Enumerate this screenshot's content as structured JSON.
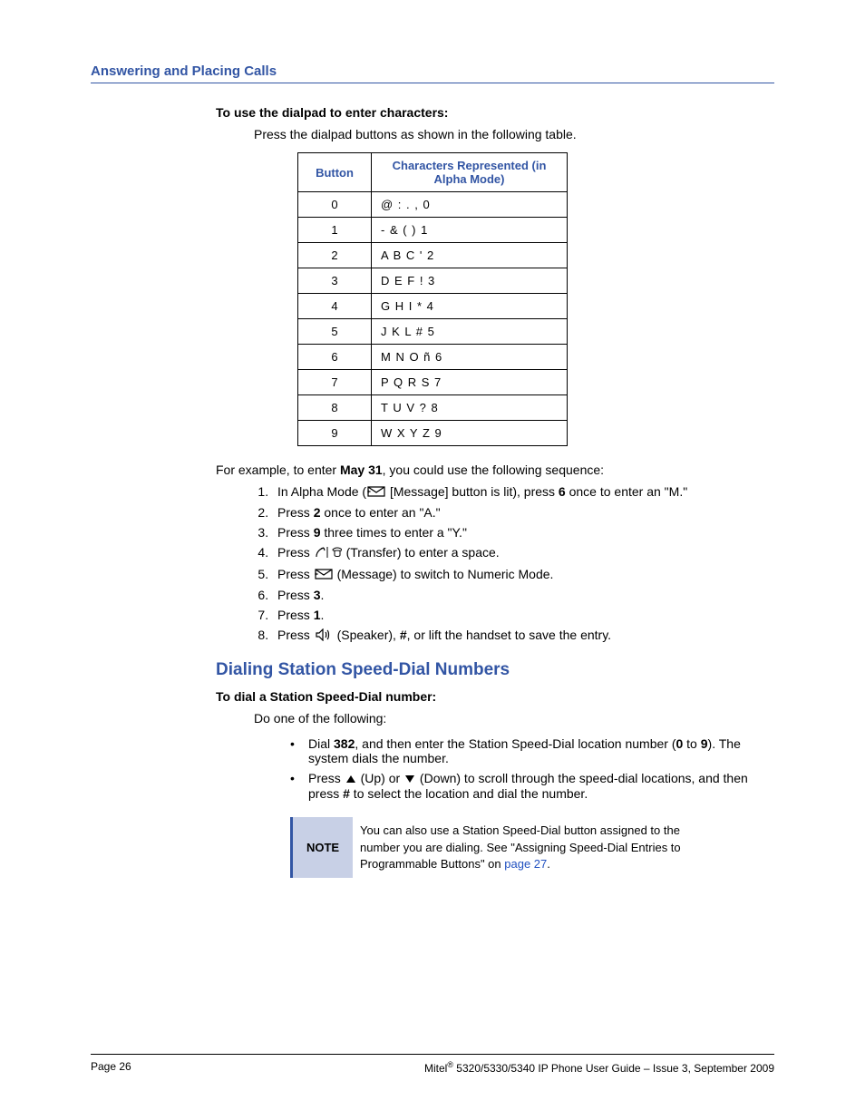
{
  "header": {
    "section": "Answering and Placing Calls"
  },
  "s1": {
    "heading": "To use the dialpad to enter characters:",
    "instruction": "Press the dialpad buttons as shown in the following table."
  },
  "table": {
    "h1": "Button",
    "h2": "Characters Represented (in Alpha Mode)",
    "rows": {
      "r0": {
        "b": "0",
        "c": "@ : . , 0"
      },
      "r1": {
        "b": "1",
        "c": "- & ( ) 1"
      },
      "r2": {
        "b": "2",
        "c": "A B C ' 2"
      },
      "r3": {
        "b": "3",
        "c": "D E F ! 3"
      },
      "r4": {
        "b": "4",
        "c": "G H I * 4"
      },
      "r5": {
        "b": "5",
        "c": "J K L # 5"
      },
      "r6": {
        "b": "6",
        "c": "M N O ñ 6"
      },
      "r7": {
        "b": "7",
        "c": "P Q R S 7"
      },
      "r8": {
        "b": "8",
        "c": "T U V ? 8"
      },
      "r9": {
        "b": "9",
        "c": "W X Y Z 9"
      }
    }
  },
  "example": {
    "intro_a": "For example, to enter ",
    "intro_b": "May 31",
    "intro_c": ", you could use the following sequence:",
    "steps": {
      "s1a": "In Alpha Mode (",
      "s1b": " [Message] button is lit), press ",
      "s1b2": "6",
      "s1c": " once to enter an \"M.\"",
      "s2a": "Press ",
      "s2b": "2",
      "s2c": " once to enter an \"A.\"",
      "s3a": "Press ",
      "s3b": "9",
      "s3c": " three times to enter a \"Y.\"",
      "s4a": "Press  ",
      "s4b": " (Transfer) to enter a space.",
      "s5a": "Press ",
      "s5b": " (Message) to switch to Numeric Mode.",
      "s6a": "Press ",
      "s6b": "3",
      "s6c": ".",
      "s7a": "Press ",
      "s7b": "1",
      "s7c": ".",
      "s8a": "Press ",
      "s8b": " (Speaker), ",
      "s8c": "#",
      "s8d": ", or lift the handset to save the entry."
    }
  },
  "s2": {
    "title": "Dialing Station Speed-Dial Numbers",
    "heading": "To dial a Station Speed-Dial number:",
    "lead": "Do one of the following:",
    "b1a": "Dial ",
    "b1b": "382",
    "b1c": ", and then enter the Station Speed-Dial location number (",
    "b1d": "0",
    "b1e": " to ",
    "b1f": "9",
    "b1g": "). The system dials the number.",
    "b2a": "Press ",
    "b2b": " (Up) or ",
    "b2c": " (Down) to scroll through the speed-dial locations, and then press ",
    "b2d": "#",
    "b2e": " to select the location and dial the number."
  },
  "note": {
    "label": "NOTE",
    "body_a": "You can also use a Station Speed-Dial button assigned to the number you are dialing. See \"Assigning Speed-Dial Entries to Programmable Buttons\" on ",
    "body_link": "page 27",
    "body_b": "."
  },
  "footer": {
    "left": "Page 26",
    "right_a": "Mitel",
    "right_b": " 5320/5330/5340 IP Phone User Guide  – Issue 3, September 2009"
  }
}
